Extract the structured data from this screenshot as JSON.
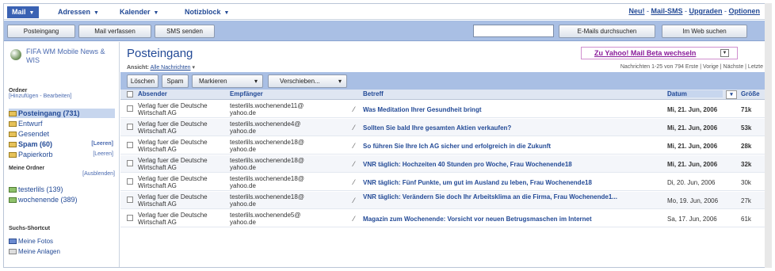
{
  "nav": {
    "tabs": [
      {
        "label": "Mail"
      },
      {
        "label": "Adressen"
      },
      {
        "label": "Kalender"
      },
      {
        "label": "Notizblock"
      }
    ],
    "links": [
      "Neu!",
      "Mail-SMS",
      "Upgraden",
      "Optionen"
    ]
  },
  "toolbar": {
    "check_mail": "Posteingang",
    "compose": "Mail verfassen",
    "sms": "SMS senden",
    "search_mail": "E-Mails durchsuchen",
    "search_web": "Im Web suchen"
  },
  "sidebar": {
    "promo": "FIFA WM Mobile News & WIS",
    "ordner_title": "Ordner",
    "ordner_sub": "[Hinzufügen - Bearbeiten]",
    "folders": [
      {
        "label": "Posteingang (731)",
        "right": ""
      },
      {
        "label": "Entwurf",
        "right": ""
      },
      {
        "label": "Gesendet",
        "right": ""
      },
      {
        "label": "Spam (60)",
        "right": "[Leeren]"
      },
      {
        "label": "Papierkorb",
        "right": "[Leeren]"
      }
    ],
    "my_folders_title": "Meine Ordner",
    "my_folders_action": "[Ausblenden]",
    "my_folders": [
      {
        "label": "testerlils (139)"
      },
      {
        "label": "wochenende (389)"
      }
    ],
    "shortcuts_title": "Suchs-Shortcut",
    "shortcuts": [
      {
        "label": "Meine Fotos"
      },
      {
        "label": "Meine Anlagen"
      }
    ]
  },
  "main": {
    "title": "Posteingang",
    "switch_label": "Zu Yahoo! Mail Beta wechseln",
    "view_label": "Ansicht:",
    "view_value": "Alle Nachrichten",
    "paging": "Nachrichten 1-25 von 794   Erste | Vorige | Nächste | Letzte",
    "actions": [
      "Löschen",
      "Spam",
      "Markieren",
      "Verschieben..."
    ],
    "columns": [
      "Absender",
      "Empfänger",
      "Betreff",
      "Datum",
      "Größe"
    ],
    "rows": [
      {
        "from": "Verlag fuer die Deutsche Wirtschaft AG",
        "to": "testerlils.wochenende11@ yahoo.de",
        "subject": "Was Meditation Ihrer Gesundheit bringt",
        "date": "Mi, 21. Jun, 2006",
        "size": "71k",
        "bold": true
      },
      {
        "from": "Verlag fuer die Deutsche Wirtschaft AG",
        "to": "testerlils.wochenende4@ yahoo.de",
        "subject": "Sollten Sie bald Ihre gesamten Aktien verkaufen?",
        "date": "Mi, 21. Jun, 2006",
        "size": "53k",
        "bold": true
      },
      {
        "from": "Verlag fuer die Deutsche Wirtschaft AG",
        "to": "testerlils.wochenende18@ yahoo.de",
        "subject": "So führen Sie Ihre Ich AG sicher und erfolgreich in die Zukunft",
        "date": "Mi, 21. Jun, 2006",
        "size": "28k",
        "bold": true
      },
      {
        "from": "Verlag fuer die Deutsche Wirtschaft AG",
        "to": "testerlils.wochenende18@ yahoo.de",
        "subject": "VNR täglich: Hochzeiten 40 Stunden pro Woche, Frau Wochenende18",
        "date": "Mi, 21. Jun, 2006",
        "size": "32k",
        "bold": true
      },
      {
        "from": "Verlag fuer die Deutsche Wirtschaft AG",
        "to": "testerlils.wochenende18@ yahoo.de",
        "subject": "VNR täglich: Fünf Punkte, um gut im Ausland zu leben, Frau Wochenende18",
        "date": "Di, 20. Jun, 2006",
        "size": "30k",
        "bold": false
      },
      {
        "from": "Verlag fuer die Deutsche Wirtschaft AG",
        "to": "testerlils.wochenende18@ yahoo.de",
        "subject": "VNR täglich: Verändern Sie doch Ihr Arbeitsklima an die Firma, Frau Wochenende1...",
        "date": "Mo, 19. Jun, 2006",
        "size": "27k",
        "bold": false
      },
      {
        "from": "Verlag fuer die Deutsche Wirtschaft AG",
        "to": "testerlils.wochenende5@ yahoo.de",
        "subject": "Magazin zum Wochenende: Vorsicht vor neuen Betrugsmaschen im Internet",
        "date": "Sa, 17. Jun, 2006",
        "size": "61k",
        "bold": false
      }
    ]
  }
}
